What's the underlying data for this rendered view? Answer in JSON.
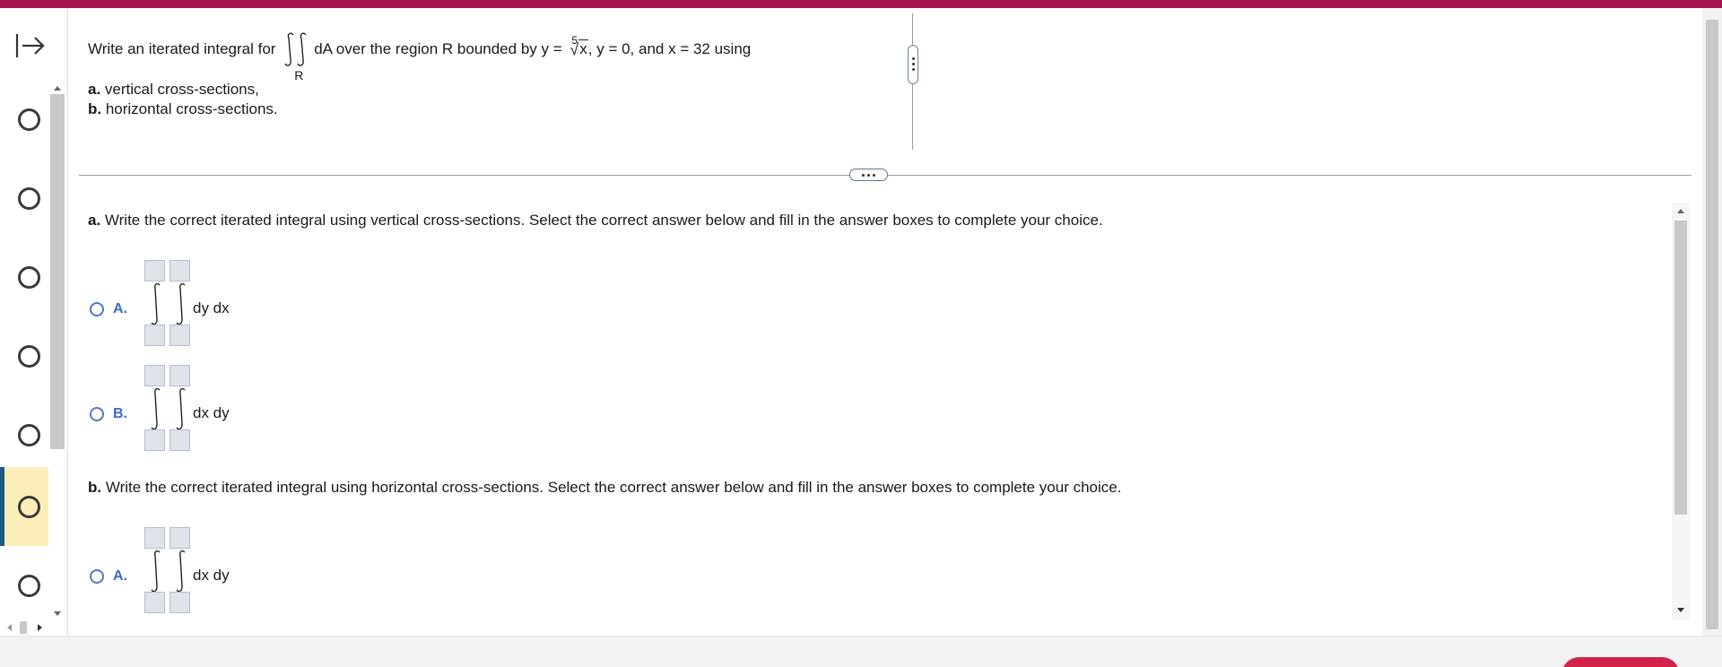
{
  "colors": {
    "brand_bar": "#a8124f",
    "active_question_bg": "#fbeeb8",
    "active_question_border": "#1e5b82",
    "choice_accent": "#3a69c4",
    "submit_button": "#d3224a"
  },
  "nav": {
    "collapse_icon": "arrow-right-to-bar-icon",
    "questions": [
      {
        "state": "unanswered",
        "active": false
      },
      {
        "state": "unanswered",
        "active": false
      },
      {
        "state": "unanswered",
        "active": false
      },
      {
        "state": "unanswered",
        "active": false
      },
      {
        "state": "unanswered",
        "active": false
      },
      {
        "state": "unanswered",
        "active": true
      },
      {
        "state": "unanswered",
        "active": false
      }
    ]
  },
  "question": {
    "intro": "Write an iterated integral for",
    "integrand": "dA over the region R bounded by y =",
    "region_sub": "R",
    "root_index": "5",
    "radicand": "x",
    "rest": ", y = 0, and x = 32 using",
    "parts": [
      {
        "label": "a.",
        "text": " vertical cross-sections,"
      },
      {
        "label": "b.",
        "text": " horizontal cross-sections."
      }
    ]
  },
  "answer": {
    "part_a": {
      "label": "a.",
      "prompt": " Write the correct iterated integral using vertical cross-sections. Select the correct answer below and fill in the answer boxes to complete your choice.",
      "choices": [
        {
          "letter": "A.",
          "differential": "dy dx"
        },
        {
          "letter": "B.",
          "differential": "dx dy"
        }
      ]
    },
    "part_b": {
      "label": "b.",
      "prompt": " Write the correct iterated integral using horizontal cross-sections. Select the correct answer below and fill in the answer boxes to complete your choice.",
      "choices": [
        {
          "letter": "A.",
          "differential": "dx dy"
        }
      ]
    }
  }
}
